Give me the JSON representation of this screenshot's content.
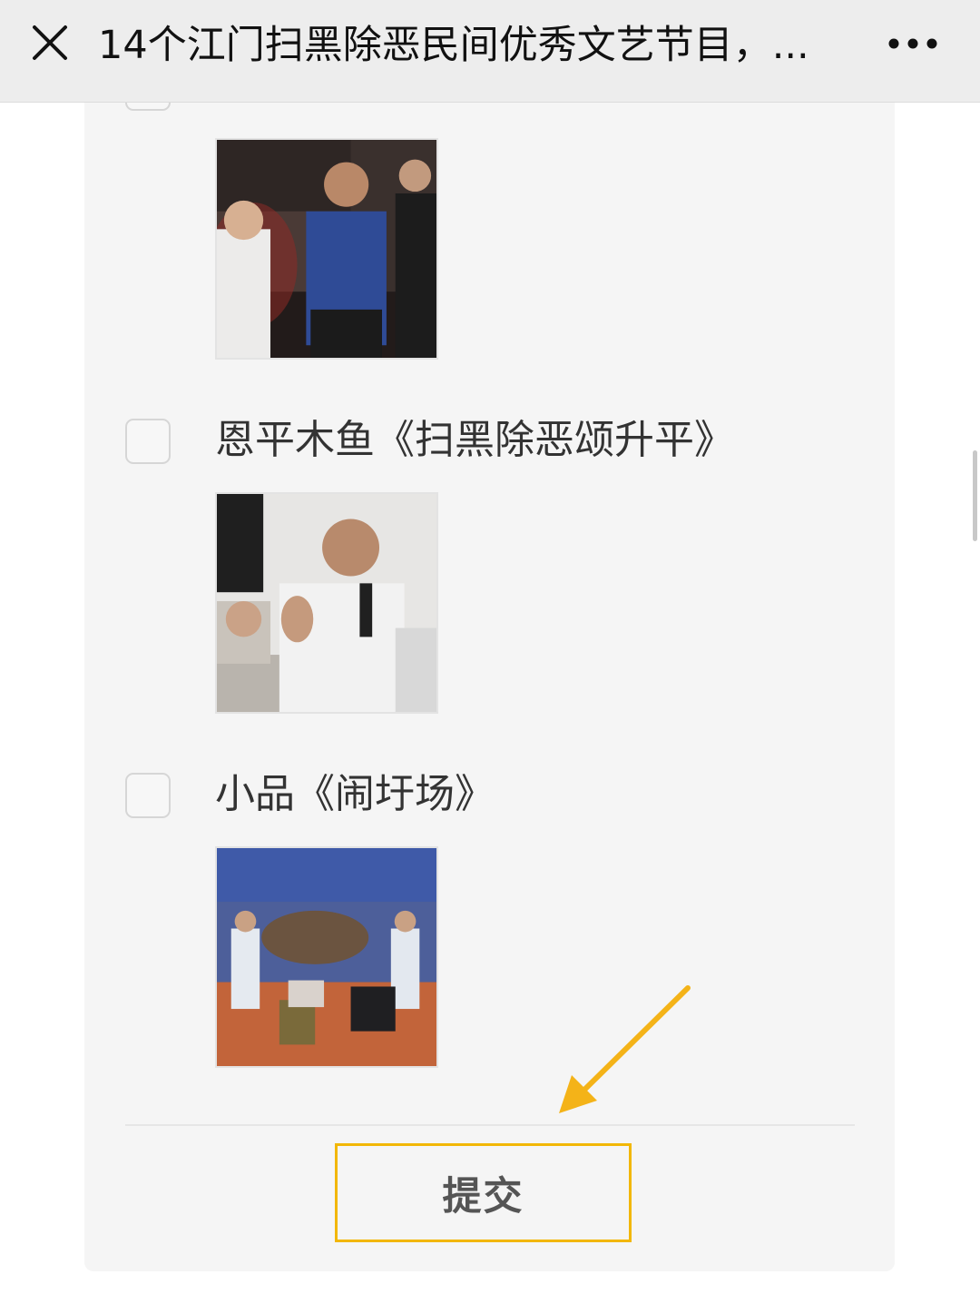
{
  "header": {
    "title": "14个江门扫黑除恶民间优秀文艺节目，...",
    "close_icon": "close-icon",
    "more_icon": "more-icon"
  },
  "options": [
    {
      "label": "",
      "checked": false
    },
    {
      "label": "恩平木鱼《扫黑除恶颂升平》",
      "checked": false
    },
    {
      "label": "小品《闹圩场》",
      "checked": false
    }
  ],
  "submit": {
    "label": "提交"
  },
  "colors": {
    "accent": "#f2b705",
    "header_bg": "#ededed",
    "card_bg": "#f5f5f5"
  }
}
